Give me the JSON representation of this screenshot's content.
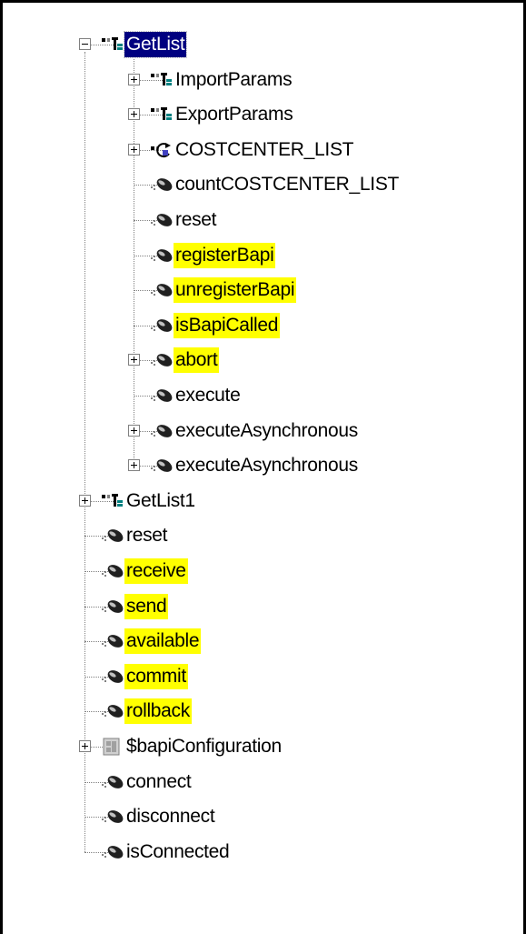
{
  "tree": [
    {
      "label": "GetList",
      "level": 0,
      "icon": "struct-icon",
      "toggle": "minus",
      "selected": true,
      "highlight": false
    },
    {
      "label": "ImportParams",
      "level": 1,
      "icon": "struct-icon",
      "toggle": "plus",
      "highlight": false
    },
    {
      "label": "ExportParams",
      "level": 1,
      "icon": "struct-icon",
      "toggle": "plus",
      "highlight": false
    },
    {
      "label": "COSTCENTER_LIST",
      "level": 1,
      "icon": "table-icon",
      "toggle": "plus",
      "highlight": false
    },
    {
      "label": "countCOSTCENTER_LIST",
      "level": 1,
      "icon": "method-icon",
      "toggle": "",
      "highlight": false
    },
    {
      "label": "reset",
      "level": 1,
      "icon": "method-icon",
      "toggle": "",
      "highlight": false
    },
    {
      "label": "registerBapi",
      "level": 1,
      "icon": "method-icon",
      "toggle": "",
      "highlight": true
    },
    {
      "label": "unregisterBapi",
      "level": 1,
      "icon": "method-icon",
      "toggle": "",
      "highlight": true
    },
    {
      "label": "isBapiCalled",
      "level": 1,
      "icon": "method-icon",
      "toggle": "",
      "highlight": true
    },
    {
      "label": "abort",
      "level": 1,
      "icon": "method-icon",
      "toggle": "plus",
      "highlight": true
    },
    {
      "label": "execute",
      "level": 1,
      "icon": "method-icon",
      "toggle": "",
      "highlight": false
    },
    {
      "label": "executeAsynchronous",
      "level": 1,
      "icon": "method-icon",
      "toggle": "plus",
      "highlight": false
    },
    {
      "label": "executeAsynchronous",
      "level": 1,
      "icon": "method-icon",
      "toggle": "plus",
      "highlight": false
    },
    {
      "label": "GetList1",
      "level": 0,
      "icon": "struct-icon",
      "toggle": "plus",
      "highlight": false
    },
    {
      "label": "reset",
      "level": 0,
      "icon": "method-icon",
      "toggle": "",
      "highlight": false
    },
    {
      "label": "receive",
      "level": 0,
      "icon": "method-icon",
      "toggle": "",
      "highlight": true
    },
    {
      "label": "send",
      "level": 0,
      "icon": "method-icon",
      "toggle": "",
      "highlight": true
    },
    {
      "label": "available",
      "level": 0,
      "icon": "method-icon",
      "toggle": "",
      "highlight": true
    },
    {
      "label": "commit",
      "level": 0,
      "icon": "method-icon",
      "toggle": "",
      "highlight": true
    },
    {
      "label": "rollback",
      "level": 0,
      "icon": "method-icon",
      "toggle": "",
      "highlight": true
    },
    {
      "label": "$bapiConfiguration",
      "level": 0,
      "icon": "config-icon",
      "toggle": "plus",
      "highlight": false
    },
    {
      "label": "connect",
      "level": 0,
      "icon": "method-icon",
      "toggle": "",
      "highlight": false
    },
    {
      "label": "disconnect",
      "level": 0,
      "icon": "method-icon",
      "toggle": "",
      "highlight": false
    },
    {
      "label": "isConnected",
      "level": 0,
      "icon": "method-icon",
      "toggle": "",
      "highlight": false
    }
  ],
  "colors": {
    "highlight": "#ffff00",
    "selection": "#000080",
    "selection_text": "#ffffff",
    "tree_line": "#808080"
  }
}
